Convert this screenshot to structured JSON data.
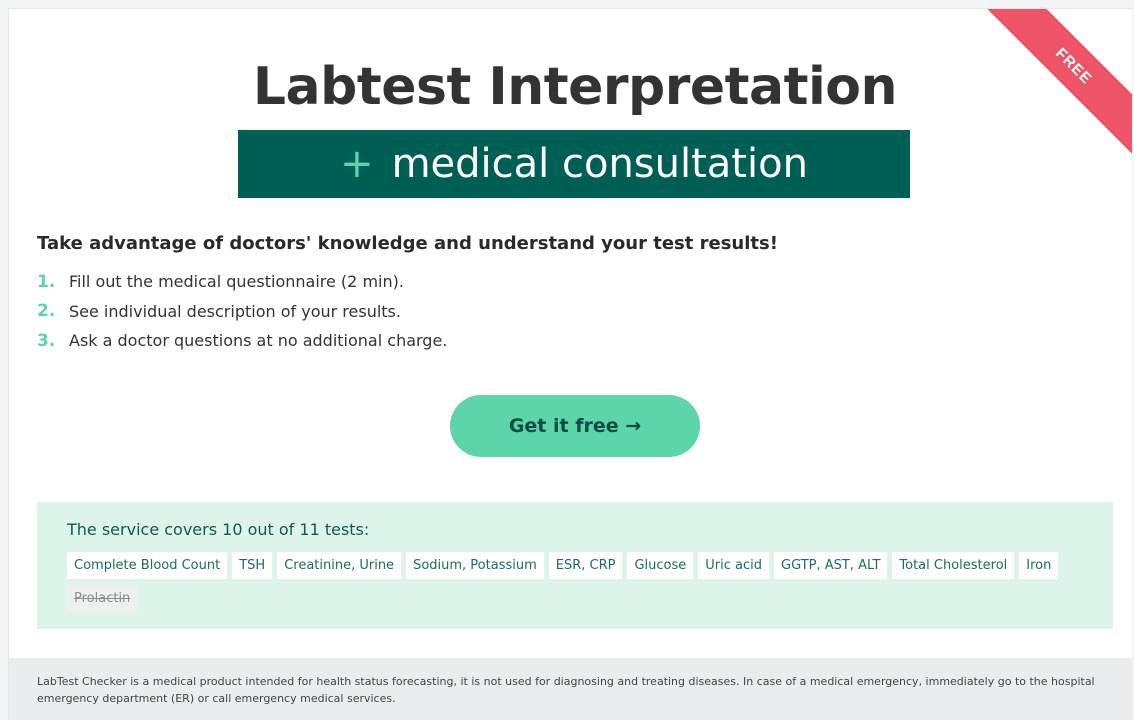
{
  "ribbon": {
    "label": "FREE"
  },
  "header": {
    "title": "Labtest Interpretation",
    "subtitle_plus": "+",
    "subtitle": "medical consultation"
  },
  "intro": {
    "headline": "Take advantage of doctors' knowledge and understand your test results!",
    "steps": [
      {
        "num": "1.",
        "text": "Fill out the medical questionnaire (2 min)."
      },
      {
        "num": "2.",
        "text": "See individual description of your results."
      },
      {
        "num": "3.",
        "text": "Ask a doctor questions at no additional charge."
      }
    ]
  },
  "cta": {
    "label": "Get it free →"
  },
  "coverage": {
    "title": "The service covers 10 out of 11 tests:",
    "tests": [
      "Complete Blood Count",
      "TSH",
      "Creatinine, Urine",
      "Sodium, Potassium",
      "ESR, CRP",
      "Glucose",
      "Uric acid",
      "GGTP, AST, ALT",
      "Total Cholesterol",
      "Iron"
    ],
    "unavailable": [
      "Prolactin"
    ]
  },
  "footer": {
    "disclaimer": "LabTest Checker is a medical product intended for health status forecasting, it is not used for diagnosing and treating diseases. In case of a medical emergency, immediately go to the hospital emergency department (ER) or call emergency medical services."
  },
  "colors": {
    "accent": "#5cd6a9",
    "brand_dark": "#005f55",
    "ribbon": "#ed5467",
    "coverage_bg": "#dcf4ea"
  }
}
